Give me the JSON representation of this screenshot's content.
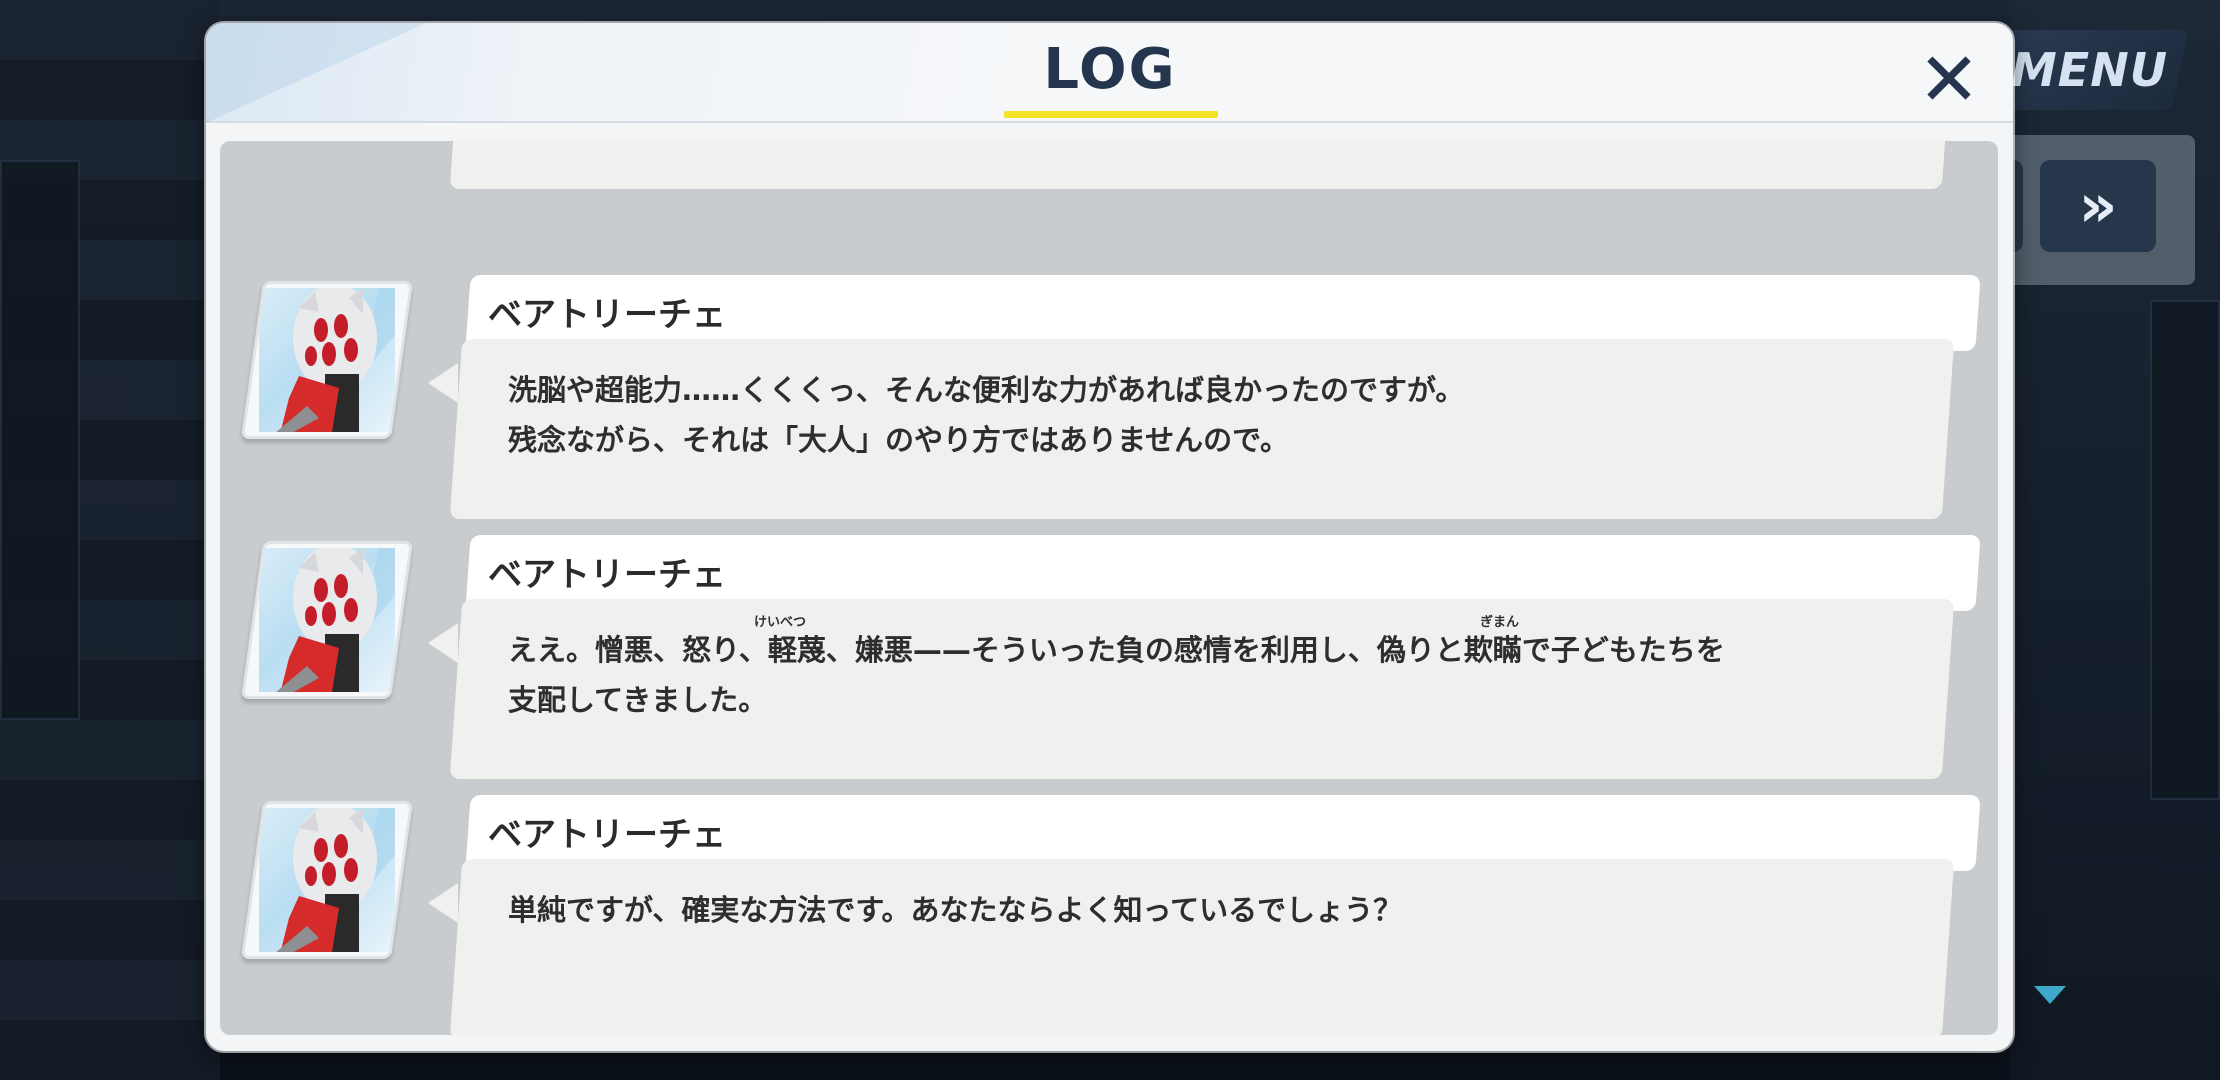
{
  "hud": {
    "menu_label": "MENU",
    "skip_icon": "fast-forward-icon",
    "skip_symbol": "»"
  },
  "log": {
    "title": "LOG",
    "close_symbol": "✕",
    "accent_color": "#f3e12a",
    "entries": [
      {
        "speaker": "",
        "message": ""
      },
      {
        "speaker": "ベアトリーチェ",
        "message": "洗脳や超能力……くくくっ、そんな便利な力があれば良かったのですが。\n残念ながら、それは「大人」のやり方ではありませんので。"
      },
      {
        "speaker": "ベアトリーチェ",
        "message": "ええ。憎悪、怒り、軽蔑、嫌悪——そういった負の感情を利用し、偽りと欺瞞で子どもたちを\n支配してきました。",
        "ruby": [
          {
            "reading": "けいべつ"
          },
          {
            "reading": "ぎまん"
          }
        ]
      },
      {
        "speaker": "ベアトリーチェ",
        "message": "単純ですが、確実な方法です。あなたならよく知っているでしょう？"
      }
    ]
  },
  "scroll": {
    "indicator_icon": "scroll-down-triangle-icon"
  }
}
